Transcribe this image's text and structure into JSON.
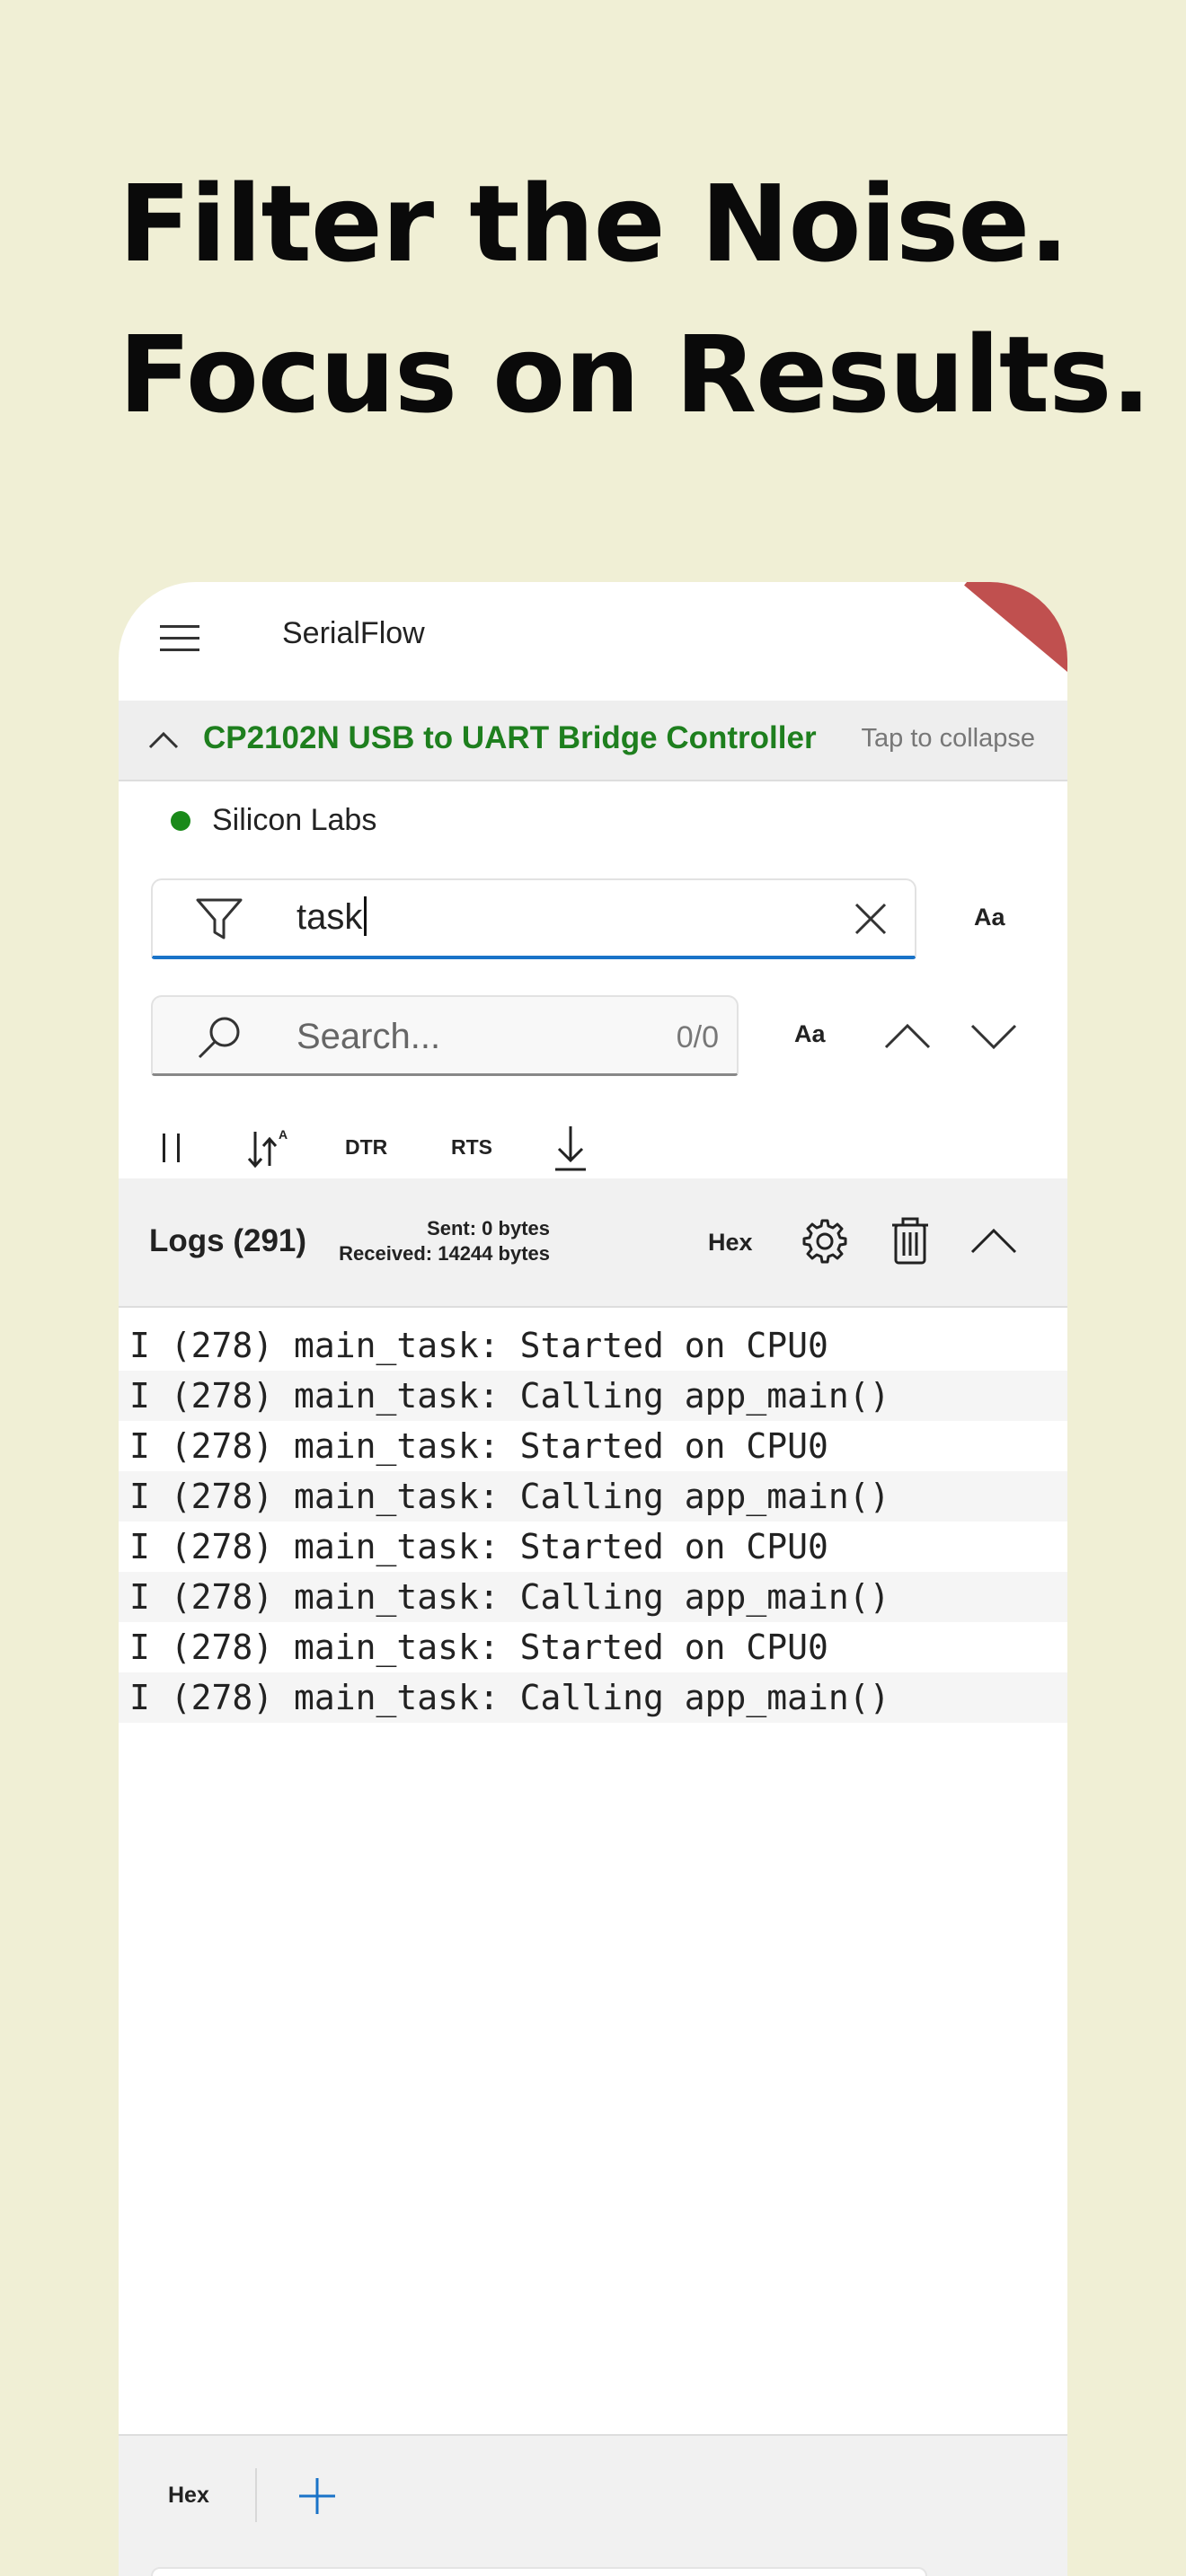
{
  "headline": {
    "line1": "Filter the Noise.",
    "line2": "Focus on Results."
  },
  "appbar": {
    "title": "SerialFlow",
    "menu_icon": "hamburger-menu-icon"
  },
  "device": {
    "name": "CP2102N USB to UART Bridge Controller",
    "collapse_hint": "Tap to collapse",
    "vendor": "Silicon Labs",
    "status_color": "#1a8a1a"
  },
  "filter": {
    "value": "task",
    "case_toggle": "Aa",
    "accent": "#1a73c8"
  },
  "search": {
    "placeholder": "Search...",
    "count": "0/0",
    "case_toggle": "Aa"
  },
  "toolbar": {
    "dtr": "DTR",
    "rts": "RTS"
  },
  "logs": {
    "title": "Logs (291)",
    "sent": "Sent: 0 bytes",
    "received": "Received: 14244 bytes",
    "hex": "Hex",
    "lines": [
      "I (278) main_task: Started on CPU0",
      "I (278) main_task: Calling app_main()",
      "I (278) main_task: Started on CPU0",
      "I (278) main_task: Calling app_main()",
      "I (278) main_task: Started on CPU0",
      "I (278) main_task: Calling app_main()",
      "I (278) main_task: Started on CPU0",
      "I (278) main_task: Calling app_main()"
    ]
  },
  "bottom": {
    "hex": "Hex"
  }
}
